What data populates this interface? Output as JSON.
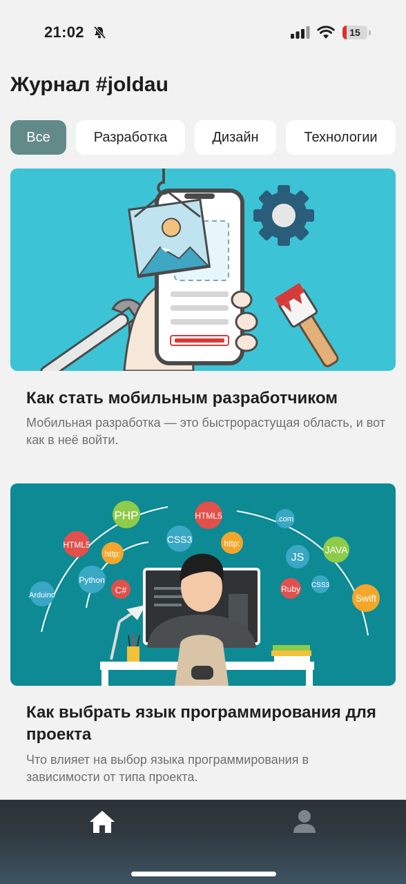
{
  "status_bar": {
    "time": "21:02",
    "battery_level": "15"
  },
  "page": {
    "title": "Журнал #joldau"
  },
  "filters": [
    {
      "label": "Все",
      "active": true
    },
    {
      "label": "Разработка",
      "active": false
    },
    {
      "label": "Дизайн",
      "active": false
    },
    {
      "label": "Технологии",
      "active": false
    }
  ],
  "articles": [
    {
      "title": "Как стать мобильным разработчиком",
      "description": "Мобильная разработка — это быстрорастущая область, и вот как в неё войти.",
      "image_icon": "mobile-app-illustration",
      "image_bg": "#3cc4d6"
    },
    {
      "title": "Как выбрать язык программирования для проекта",
      "description": "Что влияет на выбор языка программирования в зависимости от типа проекта.",
      "image_icon": "programming-languages-illustration",
      "image_bg": "#0d8a94",
      "image_labels": {
        "php": "PHP",
        "html5_left": "HTML5",
        "html5_center": "HTML5",
        "css3": "CSS3",
        "http_left": "http:",
        "http_center": "http:",
        "python": "Python",
        "csharp": "C#",
        "arduino": "Arduino",
        "com": ".com",
        "js": "JS",
        "java": "JAVA",
        "ruby": "Ruby",
        "css3_right": "CSS3",
        "swift": "Swift"
      }
    }
  ],
  "tab_bar": {
    "items": [
      {
        "icon": "home-icon",
        "active": true
      },
      {
        "icon": "profile-icon",
        "active": false
      }
    ]
  },
  "colors": {
    "accent": "#628a88",
    "background": "#f2f2f2",
    "tab_bar": "#2f393f"
  }
}
